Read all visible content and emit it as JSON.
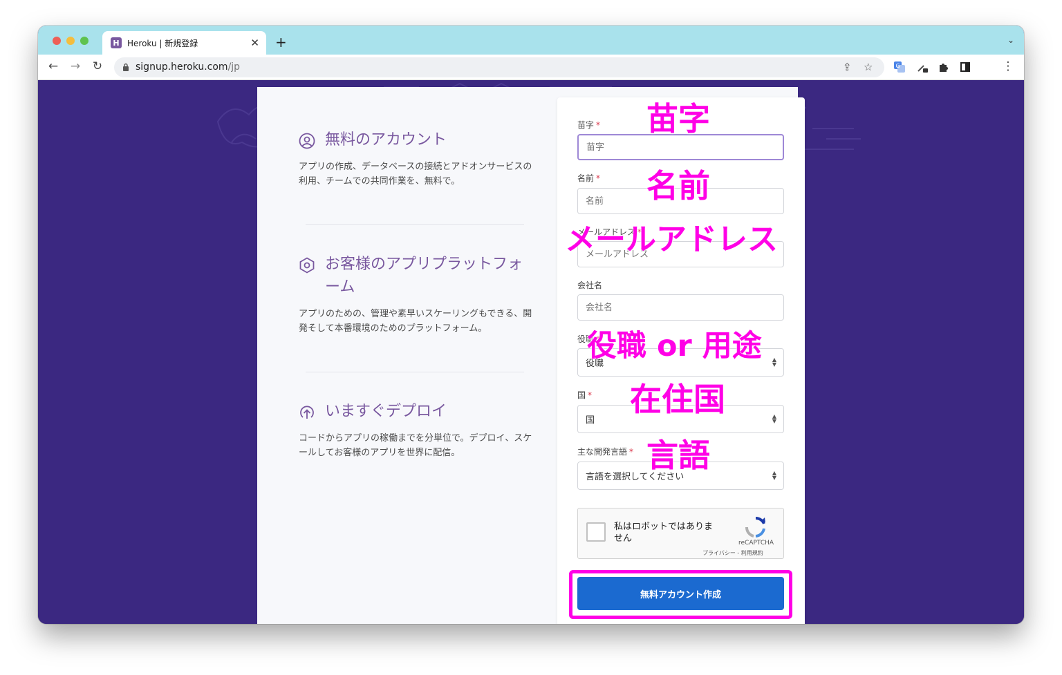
{
  "browser": {
    "tab_title": "Heroku | 新規登録",
    "tab_favicon": "H",
    "tab_close": "✕",
    "new_tab": "+",
    "tab_menu": "⌄",
    "url_host": "signup.heroku.com",
    "url_path": "/jp",
    "back": "←",
    "forward": "→",
    "reload": "↻",
    "share": "⇪",
    "bookmark": "☆",
    "menu": "⋮"
  },
  "features": [
    {
      "title": "無料のアカウント",
      "desc": "アプリの作成、データベースの接続とアドオンサービスの利用、チームでの共同作業を、無料で。",
      "icon": "user-circle-icon"
    },
    {
      "title": "お客様のアプリプラットフォーム",
      "desc": "アプリのための、管理や素早いスケーリングもできる、開発そして本番環境のためのプラットフォーム。",
      "icon": "hexagon-icon"
    },
    {
      "title": "いますぐデプロイ",
      "desc": "コードからアプリの稼働までを分単位で。デプロイ、スケールしてお客様のアプリを世界に配信。",
      "icon": "upload-circle-icon"
    }
  ],
  "form": {
    "last_name": {
      "label": "苗字",
      "req": "*",
      "placeholder": "苗字"
    },
    "first_name": {
      "label": "名前",
      "req": "*",
      "placeholder": "名前"
    },
    "email": {
      "label": "メールアドレス",
      "req": "*",
      "placeholder": "メールアドレス"
    },
    "company": {
      "label": "会社名",
      "placeholder": "会社名"
    },
    "role": {
      "label": "役職",
      "req": "*",
      "value": "役職"
    },
    "country": {
      "label": "国",
      "req": "*",
      "value": "国"
    },
    "language": {
      "label": "主な開発言語",
      "req": "*",
      "value": "言語を選択してください"
    },
    "arrows_up": "▲",
    "arrows_down": "▼",
    "captcha": {
      "text": "私はロボットではありません",
      "brand": "reCAPTCHA",
      "links": "プライバシー - 利用規約"
    },
    "submit": "無料アカウント作成"
  },
  "annotations": {
    "last_name": "苗字",
    "first_name": "名前",
    "email": "メールアドレス",
    "role": "役職 or 用途",
    "country": "在住国",
    "language": "言語"
  },
  "colors": {
    "heroku_purple": "#79589f",
    "bg_purple": "#3b2881",
    "button_blue": "#1b6ad0",
    "annotation_magenta": "#ff00e6"
  }
}
